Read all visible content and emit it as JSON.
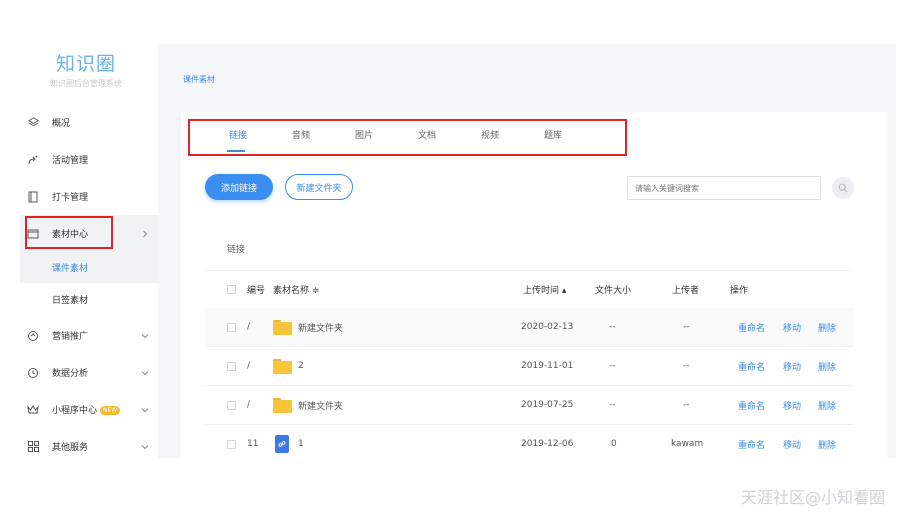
{
  "brand": {
    "title": "知识圈",
    "subtitle": "知识圈后台管理系统"
  },
  "sidebar": {
    "items": [
      {
        "label": "概况",
        "icon": "layers-icon"
      },
      {
        "label": "活动管理",
        "icon": "activity-icon"
      },
      {
        "label": "打卡管理",
        "icon": "book-icon"
      },
      {
        "label": "素材中心",
        "icon": "folder-icon"
      },
      {
        "label": "营销推广",
        "icon": "marketing-icon"
      },
      {
        "label": "数据分析",
        "icon": "clock-icon"
      },
      {
        "label": "小程序中心",
        "icon": "crown-icon",
        "badge": "NEW"
      },
      {
        "label": "其他服务",
        "icon": "grid-icon"
      }
    ],
    "sub_items": [
      {
        "label": "课件素材"
      },
      {
        "label": "日签素材"
      }
    ]
  },
  "breadcrumb": "课件素材",
  "tabs": [
    "链接",
    "音频",
    "图片",
    "文档",
    "视频",
    "题库"
  ],
  "toolbar": {
    "add_link": "添加链接",
    "new_folder": "新建文件夹",
    "search_placeholder": "请输入关键词搜索"
  },
  "table": {
    "caption": "链接",
    "headers": {
      "id": "编号",
      "name": "素材名称 ≑",
      "upload_time": "上传时间 ▴",
      "size": "文件大小",
      "uploader": "上传者",
      "actions": "操作"
    },
    "rows": [
      {
        "id": "/",
        "type": "folder",
        "name": "新建文件夹",
        "date": "2020-02-13",
        "size": "--",
        "uploader": "--"
      },
      {
        "id": "/",
        "type": "folder",
        "name": "2",
        "date": "2019-11-01",
        "size": "--",
        "uploader": "--"
      },
      {
        "id": "/",
        "type": "folder",
        "name": "新建文件夹",
        "date": "2019-07-25",
        "size": "--",
        "uploader": "--"
      },
      {
        "id": "11",
        "type": "link",
        "name": "1",
        "date": "2019-12-06",
        "size": "0",
        "uploader": "kawam"
      }
    ],
    "row_actions": {
      "rename": "重命名",
      "move": "移动",
      "delete": "删除"
    }
  },
  "watermark": "天涯社区@小知看圈",
  "colors": {
    "accent": "#3a8ee6",
    "highlight_box": "#e0252a",
    "folder": "#f8c43a"
  }
}
